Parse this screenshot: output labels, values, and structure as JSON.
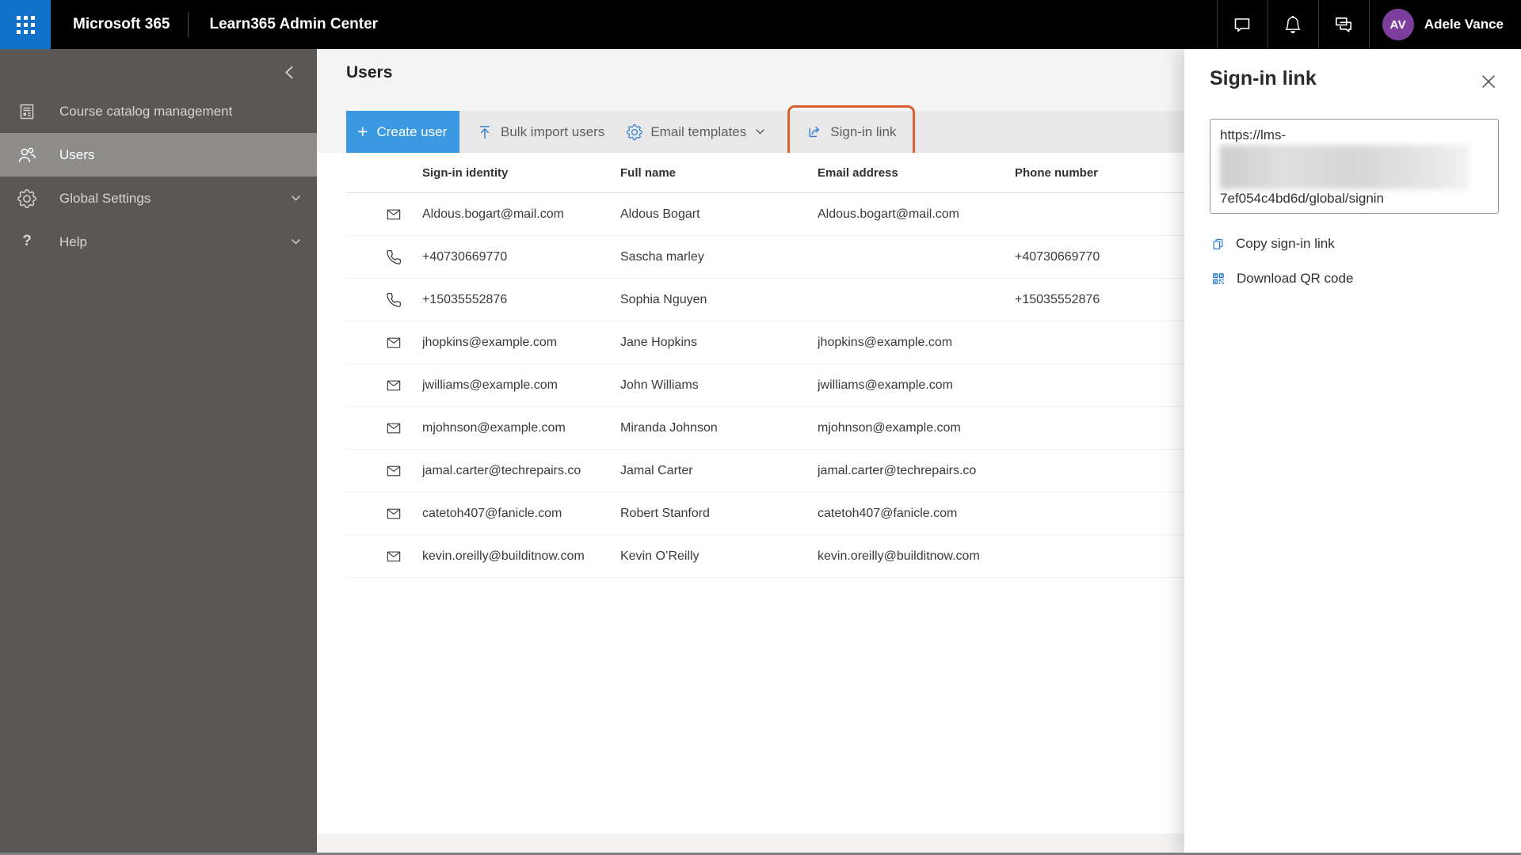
{
  "topbar": {
    "brand": "Microsoft 365",
    "app": "Learn365 Admin Center",
    "user": {
      "initials": "AV",
      "name": "Adele Vance"
    }
  },
  "sidebar": {
    "items": [
      {
        "label": "Course catalog management",
        "icon": "catalog",
        "selected": false,
        "expandable": false
      },
      {
        "label": "Users",
        "icon": "people",
        "selected": true,
        "expandable": false
      },
      {
        "label": "Global Settings",
        "icon": "gear",
        "selected": false,
        "expandable": true
      },
      {
        "label": "Help",
        "icon": "help",
        "selected": false,
        "expandable": true
      }
    ]
  },
  "main": {
    "title": "Users",
    "toolbar": {
      "create_user": "Create user",
      "bulk_import": "Bulk import users",
      "email_templates": "Email templates",
      "sign_in_link": "Sign-in link"
    },
    "table": {
      "columns": [
        "Sign-in identity",
        "Full name",
        "Email address",
        "Phone number"
      ],
      "rows": [
        {
          "icon": "mail",
          "identity": "Aldous.bogart@mail.com",
          "full_name": "Aldous Bogart",
          "email": "Aldous.bogart@mail.com",
          "phone": ""
        },
        {
          "icon": "phone",
          "identity": "+40730669770",
          "full_name": "Sascha marley",
          "email": "",
          "phone": "+40730669770"
        },
        {
          "icon": "phone",
          "identity": "+15035552876",
          "full_name": "Sophia Nguyen",
          "email": "",
          "phone": "+15035552876"
        },
        {
          "icon": "mail",
          "identity": "jhopkins@example.com",
          "full_name": "Jane Hopkins",
          "email": "jhopkins@example.com",
          "phone": ""
        },
        {
          "icon": "mail",
          "identity": "jwilliams@example.com",
          "full_name": "John Williams",
          "email": "jwilliams@example.com",
          "phone": ""
        },
        {
          "icon": "mail",
          "identity": "mjohnson@example.com",
          "full_name": "Miranda Johnson",
          "email": "mjohnson@example.com",
          "phone": ""
        },
        {
          "icon": "mail",
          "identity": "jamal.carter@techrepairs.co",
          "full_name": "Jamal Carter",
          "email": "jamal.carter@techrepairs.co",
          "phone": ""
        },
        {
          "icon": "mail",
          "identity": "catetoh407@fanicle.com",
          "full_name": "Robert Stanford",
          "email": "catetoh407@fanicle.com",
          "phone": ""
        },
        {
          "icon": "mail",
          "identity": "kevin.oreilly@builditnow.com",
          "full_name": "Kevin O’Reilly",
          "email": "kevin.oreilly@builditnow.com",
          "phone": ""
        }
      ]
    }
  },
  "panel": {
    "title": "Sign-in link",
    "url_line1": "https://lms-",
    "url_line2": "7ef054c4bd6d/global/signin",
    "copy_label": "Copy sign-in link",
    "qr_label": "Download QR code"
  },
  "colors": {
    "topbar_bg": "#000000",
    "waffle_bg": "#1071c9",
    "accent_blue": "#2b7cd3",
    "create_button_bg": "#3a99e0",
    "highlight_orange": "#d95f2e",
    "avatar_purple": "#7d3f9e",
    "sidebar_bg": "#5a5856",
    "sidebar_selected_bg": "#8f8d8b"
  }
}
